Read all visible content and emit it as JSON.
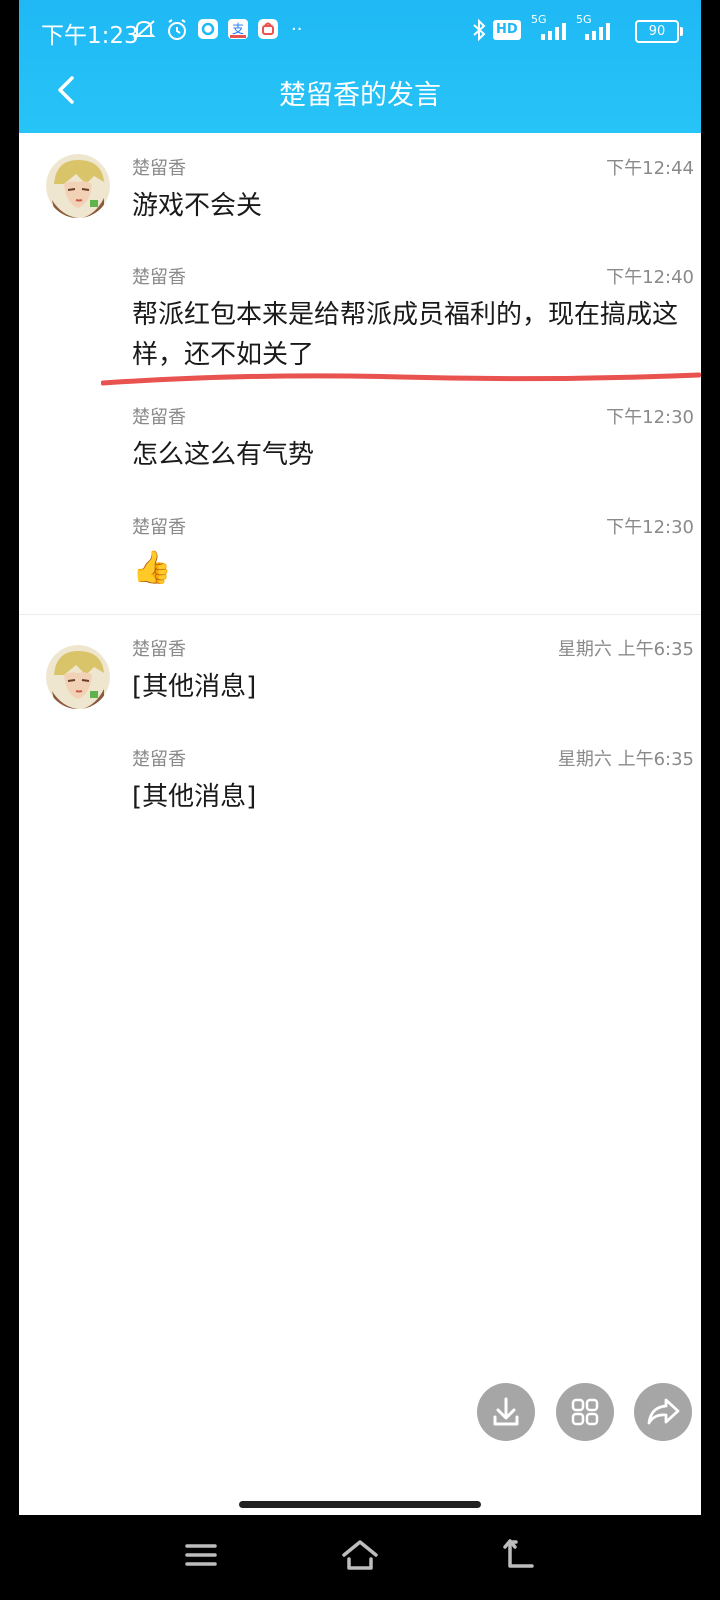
{
  "status_bar": {
    "time": "下午1:23",
    "network_badge": "HD",
    "signal_1_label": "5G",
    "signal_2_label": "5G",
    "battery": "90"
  },
  "nav": {
    "title": "楚留香的发言",
    "back_icon": "chevron-left-icon"
  },
  "messages": [
    {
      "sender": "楚留香",
      "time": "下午12:44",
      "text": "游戏不会关"
    },
    {
      "sender": "楚留香",
      "time": "下午12:40",
      "text": "帮派红包本来是给帮派成员福利的，现在搞成这样，还不如关了"
    },
    {
      "sender": "楚留香",
      "time": "下午12:30",
      "text": "怎么这么有气势"
    },
    {
      "sender": "楚留香",
      "time": "下午12:30",
      "emoji": "👍"
    },
    {
      "sender": "楚留香",
      "time": "星期六 上午6:35",
      "text": "[其他消息]"
    },
    {
      "sender": "楚留香",
      "time": "星期六 上午6:35",
      "text": "[其他消息]"
    }
  ],
  "actions": {
    "download_icon": "download-icon",
    "grid_icon": "grid-icon",
    "share_icon": "share-icon"
  },
  "colors": {
    "header": "#1fb8f5",
    "annotation": "#e8524f",
    "fab": "#a6a6a6"
  }
}
